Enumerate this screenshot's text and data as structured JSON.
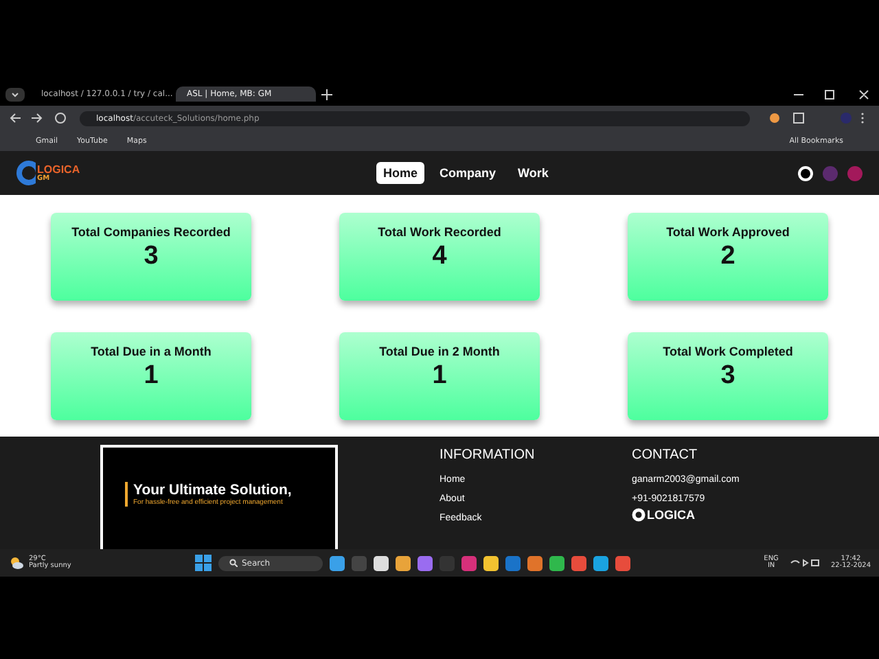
{
  "browser": {
    "tabs": [
      {
        "title": "localhost / 127.0.0.1 / try / cal...",
        "selected": false
      },
      {
        "title": "ASL | Home, MB: GM",
        "selected": true
      }
    ],
    "address_host": "localhost",
    "address_path": "/accuteck_Solutions/home.php",
    "bookmarks": [
      "Gmail",
      "YouTube",
      "Maps"
    ],
    "all_bookmarks": "All Bookmarks"
  },
  "nav": {
    "logo": "LOGICA",
    "logo_sub": "GM",
    "links": [
      {
        "label": "Home",
        "selected": true
      },
      {
        "label": "Company",
        "selected": false
      },
      {
        "label": "Work",
        "selected": false
      }
    ],
    "themes": [
      {
        "color": "#ffffff",
        "selected": true
      },
      {
        "color": "#5b2a6e",
        "selected": false
      },
      {
        "color": "#a3195b",
        "selected": false
      }
    ]
  },
  "stats": [
    {
      "title": "Total Companies Recorded",
      "value": "3"
    },
    {
      "title": "Total Work Recorded",
      "value": "4"
    },
    {
      "title": "Total Work Approved",
      "value": "2"
    },
    {
      "title": "Total Due in a Month",
      "value": "1"
    },
    {
      "title": "Total Due in 2 Month",
      "value": "1"
    },
    {
      "title": "Total Work Completed",
      "value": "3"
    }
  ],
  "footer": {
    "banner_title": "Your Ultimate Solution,",
    "banner_subtitle": "For hassle-free and efficient project management",
    "information": {
      "heading": "INFORMATION",
      "links": [
        "Home",
        "About",
        "Feedback"
      ]
    },
    "contact": {
      "heading": "CONTACT",
      "email": "ganarm2003@gmail.com",
      "phone": "+91-9021817579",
      "logo": "LOGICA"
    }
  },
  "taskbar": {
    "temperature": "29°C",
    "weather": "Partly sunny",
    "search": "Search",
    "language": "ENG",
    "region": "IN",
    "time": "17:42",
    "date": "22-12-2024"
  }
}
